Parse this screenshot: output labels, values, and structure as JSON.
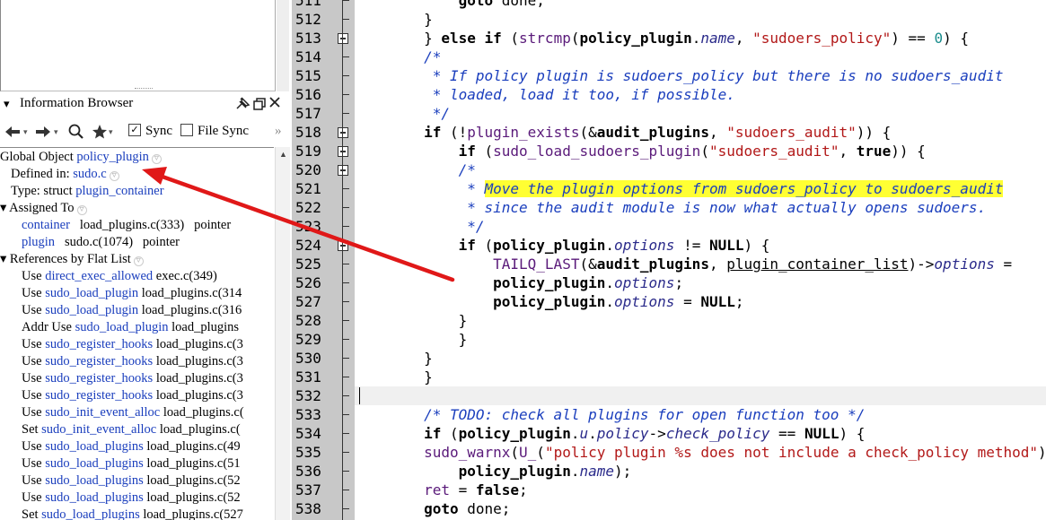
{
  "info_browser": {
    "title": "Information Browser",
    "header_icons": [
      "pin-icon",
      "restore-icon",
      "close-icon"
    ],
    "toolbar": {
      "sync_label": "Sync",
      "sync_checked": true,
      "file_sync_label": "File Sync",
      "file_sync_checked": false,
      "more": "»"
    }
  },
  "tree": [
    {
      "prefix": "Global  Object ",
      "link": "policy_plugin",
      "suffix": "",
      "indent": 0,
      "has_toggle": true
    },
    {
      "prefix": "Defined  in: ",
      "link": "sudo.c",
      "suffix": "",
      "indent": 12,
      "has_toggle": true
    },
    {
      "prefix": "Type: struct ",
      "link": "plugin_container",
      "suffix": "",
      "indent": 12,
      "has_toggle": false
    },
    {
      "prefix": "▾ Assigned  To",
      "link": "",
      "suffix": "",
      "indent": 0,
      "has_toggle": true
    },
    {
      "prefix": "",
      "link": "container",
      "suffix": "   load_plugins.c(333)   pointer",
      "indent": 24,
      "has_toggle": false
    },
    {
      "prefix": "",
      "link": "plugin",
      "suffix": "   sudo.c(1074)   pointer",
      "indent": 24,
      "has_toggle": false
    },
    {
      "prefix": "▾ References  by  Flat List",
      "link": "",
      "suffix": "",
      "indent": 0,
      "has_toggle": true
    },
    {
      "prefix": "Use  ",
      "link": "direct_exec_allowed",
      "suffix": "    exec.c(349)",
      "indent": 24,
      "has_toggle": false
    },
    {
      "prefix": "Use  ",
      "link": "sudo_load_plugin",
      "suffix": "    load_plugins.c(314",
      "indent": 24,
      "has_toggle": false
    },
    {
      "prefix": "Use  ",
      "link": "sudo_load_plugin",
      "suffix": "    load_plugins.c(316",
      "indent": 24,
      "has_toggle": false
    },
    {
      "prefix": "Addr  Use  ",
      "link": "sudo_load_plugin",
      "suffix": "    load_plugins",
      "indent": 24,
      "has_toggle": false
    },
    {
      "prefix": "Use  ",
      "link": "sudo_register_hooks",
      "suffix": "    load_plugins.c(3",
      "indent": 24,
      "has_toggle": false
    },
    {
      "prefix": "Use  ",
      "link": "sudo_register_hooks",
      "suffix": "    load_plugins.c(3",
      "indent": 24,
      "has_toggle": false
    },
    {
      "prefix": "Use  ",
      "link": "sudo_register_hooks",
      "suffix": "    load_plugins.c(3",
      "indent": 24,
      "has_toggle": false
    },
    {
      "prefix": "Use  ",
      "link": "sudo_register_hooks",
      "suffix": "    load_plugins.c(3",
      "indent": 24,
      "has_toggle": false
    },
    {
      "prefix": "Use  ",
      "link": "sudo_init_event_alloc",
      "suffix": "    load_plugins.c(",
      "indent": 24,
      "has_toggle": false
    },
    {
      "prefix": "Set  ",
      "link": "sudo_init_event_alloc",
      "suffix": "    load_plugins.c(",
      "indent": 24,
      "has_toggle": false
    },
    {
      "prefix": "Use  ",
      "link": "sudo_load_plugins",
      "suffix": "    load_plugins.c(49",
      "indent": 24,
      "has_toggle": false
    },
    {
      "prefix": "Use  ",
      "link": "sudo_load_plugins",
      "suffix": "    load_plugins.c(51",
      "indent": 24,
      "has_toggle": false
    },
    {
      "prefix": "Use  ",
      "link": "sudo_load_plugins",
      "suffix": "    load_plugins.c(52",
      "indent": 24,
      "has_toggle": false
    },
    {
      "prefix": "Use  ",
      "link": "sudo_load_plugins",
      "suffix": "    load_plugins.c(52",
      "indent": 24,
      "has_toggle": false
    },
    {
      "prefix": "Set  ",
      "link": "sudo_load_plugins",
      "suffix": "    load_plugins.c(527",
      "indent": 24,
      "has_toggle": false
    }
  ],
  "line_numbers": [
    "511",
    "512",
    "513",
    "514",
    "515",
    "516",
    "517",
    "518",
    "519",
    "520",
    "521",
    "522",
    "523",
    "524",
    "525",
    "526",
    "527",
    "528",
    "529",
    "530",
    "531",
    "532",
    "533",
    "534",
    "535",
    "536",
    "537",
    "538"
  ],
  "code": [
    [
      {
        "t": "            "
      },
      {
        "t": "goto",
        "c": "kw"
      },
      {
        "t": " done;"
      }
    ],
    [
      {
        "t": "        }"
      }
    ],
    [
      {
        "t": "        } "
      },
      {
        "t": "else if",
        "c": "kw"
      },
      {
        "t": " ("
      },
      {
        "t": "strcmp",
        "c": "fn"
      },
      {
        "t": "("
      },
      {
        "t": "policy_plugin",
        "c": "kw"
      },
      {
        "t": "."
      },
      {
        "t": "name",
        "c": "mem"
      },
      {
        "t": ", "
      },
      {
        "t": "\"sudoers_policy\"",
        "c": "str"
      },
      {
        "t": ") == "
      },
      {
        "t": "0",
        "c": "num"
      },
      {
        "t": ") {"
      }
    ],
    [
      {
        "t": "        "
      },
      {
        "t": "/*",
        "c": "cm"
      }
    ],
    [
      {
        "t": "        "
      },
      {
        "t": " * If policy plugin is sudoers_policy but there is no sudoers_audit",
        "c": "cm"
      }
    ],
    [
      {
        "t": "        "
      },
      {
        "t": " * loaded, load it too, if possible.",
        "c": "cm"
      }
    ],
    [
      {
        "t": "        "
      },
      {
        "t": " */",
        "c": "cm"
      }
    ],
    [
      {
        "t": "        "
      },
      {
        "t": "if",
        "c": "kw"
      },
      {
        "t": " (!"
      },
      {
        "t": "plugin_exists",
        "c": "fn"
      },
      {
        "t": "(&"
      },
      {
        "t": "audit_plugins",
        "c": "kw"
      },
      {
        "t": ", "
      },
      {
        "t": "\"sudoers_audit\"",
        "c": "str"
      },
      {
        "t": ")) {"
      }
    ],
    [
      {
        "t": "            "
      },
      {
        "t": "if",
        "c": "kw"
      },
      {
        "t": " ("
      },
      {
        "t": "sudo_load_sudoers_plugin",
        "c": "fn"
      },
      {
        "t": "("
      },
      {
        "t": "\"sudoers_audit\"",
        "c": "str"
      },
      {
        "t": ", "
      },
      {
        "t": "true",
        "c": "kw"
      },
      {
        "t": ")) {"
      }
    ],
    [
      {
        "t": "            "
      },
      {
        "t": "/*",
        "c": "cm"
      }
    ],
    [
      {
        "t": "            "
      },
      {
        "t": " * ",
        "c": "cm"
      },
      {
        "t": "Move the plugin options from sudoers_policy to sudoers_audit",
        "c": "cm hl"
      }
    ],
    [
      {
        "t": "            "
      },
      {
        "t": " * since the audit module is now what actually opens sudoers.",
        "c": "cm"
      }
    ],
    [
      {
        "t": "            "
      },
      {
        "t": " */",
        "c": "cm"
      }
    ],
    [
      {
        "t": "            "
      },
      {
        "t": "if",
        "c": "kw"
      },
      {
        "t": " ("
      },
      {
        "t": "policy_plugin",
        "c": "kw"
      },
      {
        "t": "."
      },
      {
        "t": "options",
        "c": "mem"
      },
      {
        "t": " != "
      },
      {
        "t": "NULL",
        "c": "kw"
      },
      {
        "t": ") {"
      }
    ],
    [
      {
        "t": "                "
      },
      {
        "t": "TAILQ_LAST",
        "c": "fn"
      },
      {
        "t": "(&"
      },
      {
        "t": "audit_plugins",
        "c": "kw"
      },
      {
        "t": ", "
      },
      {
        "t": "plugin_container_list",
        "c": "ul"
      },
      {
        "t": ")->"
      },
      {
        "t": "options",
        "c": "mem"
      },
      {
        "t": " ="
      }
    ],
    [
      {
        "t": "                "
      },
      {
        "t": "policy_plugin",
        "c": "kw"
      },
      {
        "t": "."
      },
      {
        "t": "options",
        "c": "mem"
      },
      {
        "t": ";"
      }
    ],
    [
      {
        "t": "                "
      },
      {
        "t": "policy_plugin",
        "c": "kw"
      },
      {
        "t": "."
      },
      {
        "t": "options",
        "c": "mem"
      },
      {
        "t": " = "
      },
      {
        "t": "NULL",
        "c": "kw"
      },
      {
        "t": ";"
      }
    ],
    [
      {
        "t": "            }"
      }
    ],
    [
      {
        "t": "            }"
      }
    ],
    [
      {
        "t": "        }"
      }
    ],
    [
      {
        "t": "        }"
      }
    ],
    [
      {
        "t": ""
      }
    ],
    [
      {
        "t": "        "
      },
      {
        "t": "/* TODO: check all plugins for open function too */",
        "c": "cm"
      }
    ],
    [
      {
        "t": "        "
      },
      {
        "t": "if",
        "c": "kw"
      },
      {
        "t": " ("
      },
      {
        "t": "policy_plugin",
        "c": "kw"
      },
      {
        "t": "."
      },
      {
        "t": "u",
        "c": "mem"
      },
      {
        "t": "."
      },
      {
        "t": "policy",
        "c": "mem"
      },
      {
        "t": "->"
      },
      {
        "t": "check_policy",
        "c": "mem"
      },
      {
        "t": " == "
      },
      {
        "t": "NULL",
        "c": "kw"
      },
      {
        "t": ") {"
      }
    ],
    [
      {
        "t": "        "
      },
      {
        "t": "sudo_warnx",
        "c": "fn"
      },
      {
        "t": "("
      },
      {
        "t": "U_",
        "c": "fn"
      },
      {
        "t": "("
      },
      {
        "t": "\"policy plugin %s does not include a check_policy method\"",
        "c": "str"
      },
      {
        "t": "),"
      }
    ],
    [
      {
        "t": "            "
      },
      {
        "t": "policy_plugin",
        "c": "kw"
      },
      {
        "t": "."
      },
      {
        "t": "name",
        "c": "mem"
      },
      {
        "t": ");"
      }
    ],
    [
      {
        "t": "        "
      },
      {
        "t": "ret",
        "c": "fn"
      },
      {
        "t": " = "
      },
      {
        "t": "false",
        "c": "kw"
      },
      {
        "t": ";"
      }
    ],
    [
      {
        "t": "        "
      },
      {
        "t": "goto",
        "c": "kw"
      },
      {
        "t": " done;"
      }
    ]
  ],
  "fold_markers": [
    "513",
    "518",
    "519",
    "520",
    "524"
  ],
  "annotation_color": "#e01818"
}
